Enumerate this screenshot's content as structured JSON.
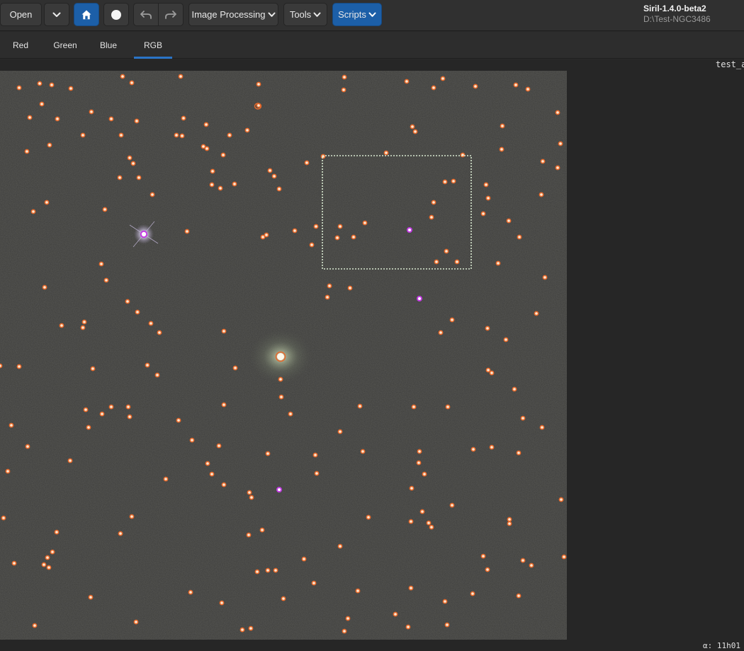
{
  "toolbar": {
    "open_label": "Open",
    "image_processing_label": "Image Processing",
    "tools_label": "Tools",
    "scripts_label": "Scripts",
    "icons": {
      "open_menu": "chevron-down-icon",
      "home": "home-icon",
      "record": "circle-icon",
      "undo": "undo-icon",
      "redo": "redo-icon"
    }
  },
  "window": {
    "title": "Siril-1.4.0-beta2",
    "path": "D:\\Test-NGC3486"
  },
  "tabs": [
    {
      "label": "Red",
      "active": false
    },
    {
      "label": "Green",
      "active": false
    },
    {
      "label": "Blue",
      "active": false
    },
    {
      "label": "RGB",
      "active": true
    }
  ],
  "image": {
    "filename": "test_a",
    "coordinate_readout": "α: 11h01",
    "colors": {
      "background": "#3d3d3b",
      "star_marker": "#e8692a",
      "highlight_marker": "#c33be3",
      "selection": "#d8e8d0",
      "accent": "#1c5fa8"
    }
  }
}
